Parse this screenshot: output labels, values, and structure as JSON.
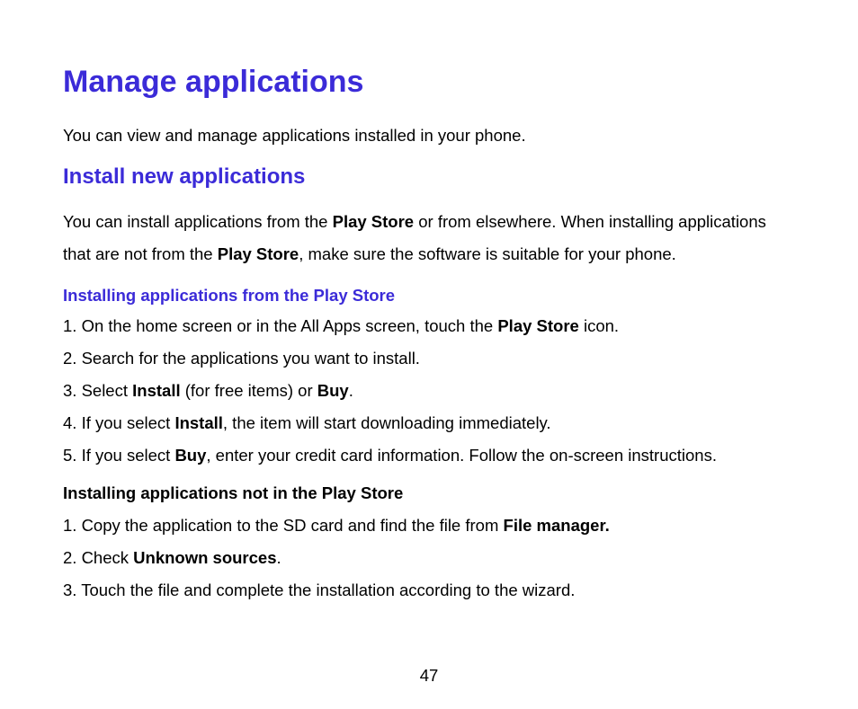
{
  "title": "Manage applications",
  "intro": "You can view and manage applications installed in your phone.",
  "section1": {
    "heading": "Install new applications",
    "para_parts": {
      "a": "You can install applications from the ",
      "b": "Play Store",
      "c": " or from elsewhere. When installing applications that are not from the ",
      "d": "Play Store",
      "e": ", make sure the software is suitable for your phone."
    },
    "sub1": {
      "heading": "Installing applications from the Play Store",
      "items": {
        "i1": {
          "a": "1. On the home screen or in the All Apps screen, touch the ",
          "b": "Play Store",
          "c": " icon."
        },
        "i2": {
          "a": "2. Search for the applications you want to install."
        },
        "i3": {
          "a": "3. Select ",
          "b": "Install",
          "c": " (for free items) or ",
          "d": "Buy",
          "e": "."
        },
        "i4": {
          "a": "4. If you select ",
          "b": "Install",
          "c": ", the item will start downloading immediately."
        },
        "i5": {
          "a": "5. If you select ",
          "b": "Buy",
          "c": ", enter your credit card information. Follow the on-screen instructions."
        }
      }
    },
    "sub2": {
      "heading": "Installing applications not in the Play Store",
      "items": {
        "i1": {
          "a": "1. Copy the application to the SD card and find the file from ",
          "b": "File manager."
        },
        "i2": {
          "a": "2. Check ",
          "b": "Unknown sources",
          "c": "."
        },
        "i3": {
          "a": "3. Touch the file and complete the installation according to the wizard."
        }
      }
    }
  },
  "page_number": "47"
}
